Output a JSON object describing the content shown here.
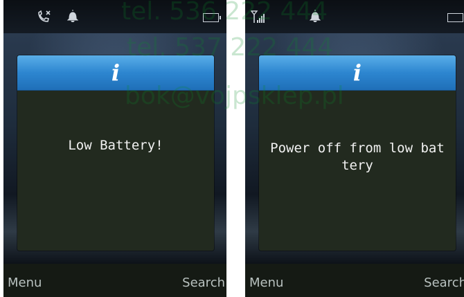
{
  "left_screen": {
    "dialog_message": "Low Battery!",
    "softkey_left": "Menu",
    "softkey_right": "Search",
    "status_icons": [
      "missed-call-icon",
      "bell-icon",
      "battery-icon"
    ]
  },
  "right_screen": {
    "dialog_message_line1": "Power off from low bat",
    "dialog_message_line2": "tery",
    "softkey_left": "Menu",
    "softkey_right": "Search",
    "status_icons": [
      "signal-icon",
      "bell-icon",
      "battery-icon"
    ]
  },
  "dialog_icon": "i",
  "watermark": {
    "line1": "tel. 536 222 444",
    "line2": "tel. 537 222 444",
    "line3": "bok@vojpsklep.pl"
  },
  "colors": {
    "header_blue": "#2d86d0",
    "dialog_bg": "#222a1f",
    "softbar_bg": "#151a14",
    "watermark": "#0a8c28"
  }
}
